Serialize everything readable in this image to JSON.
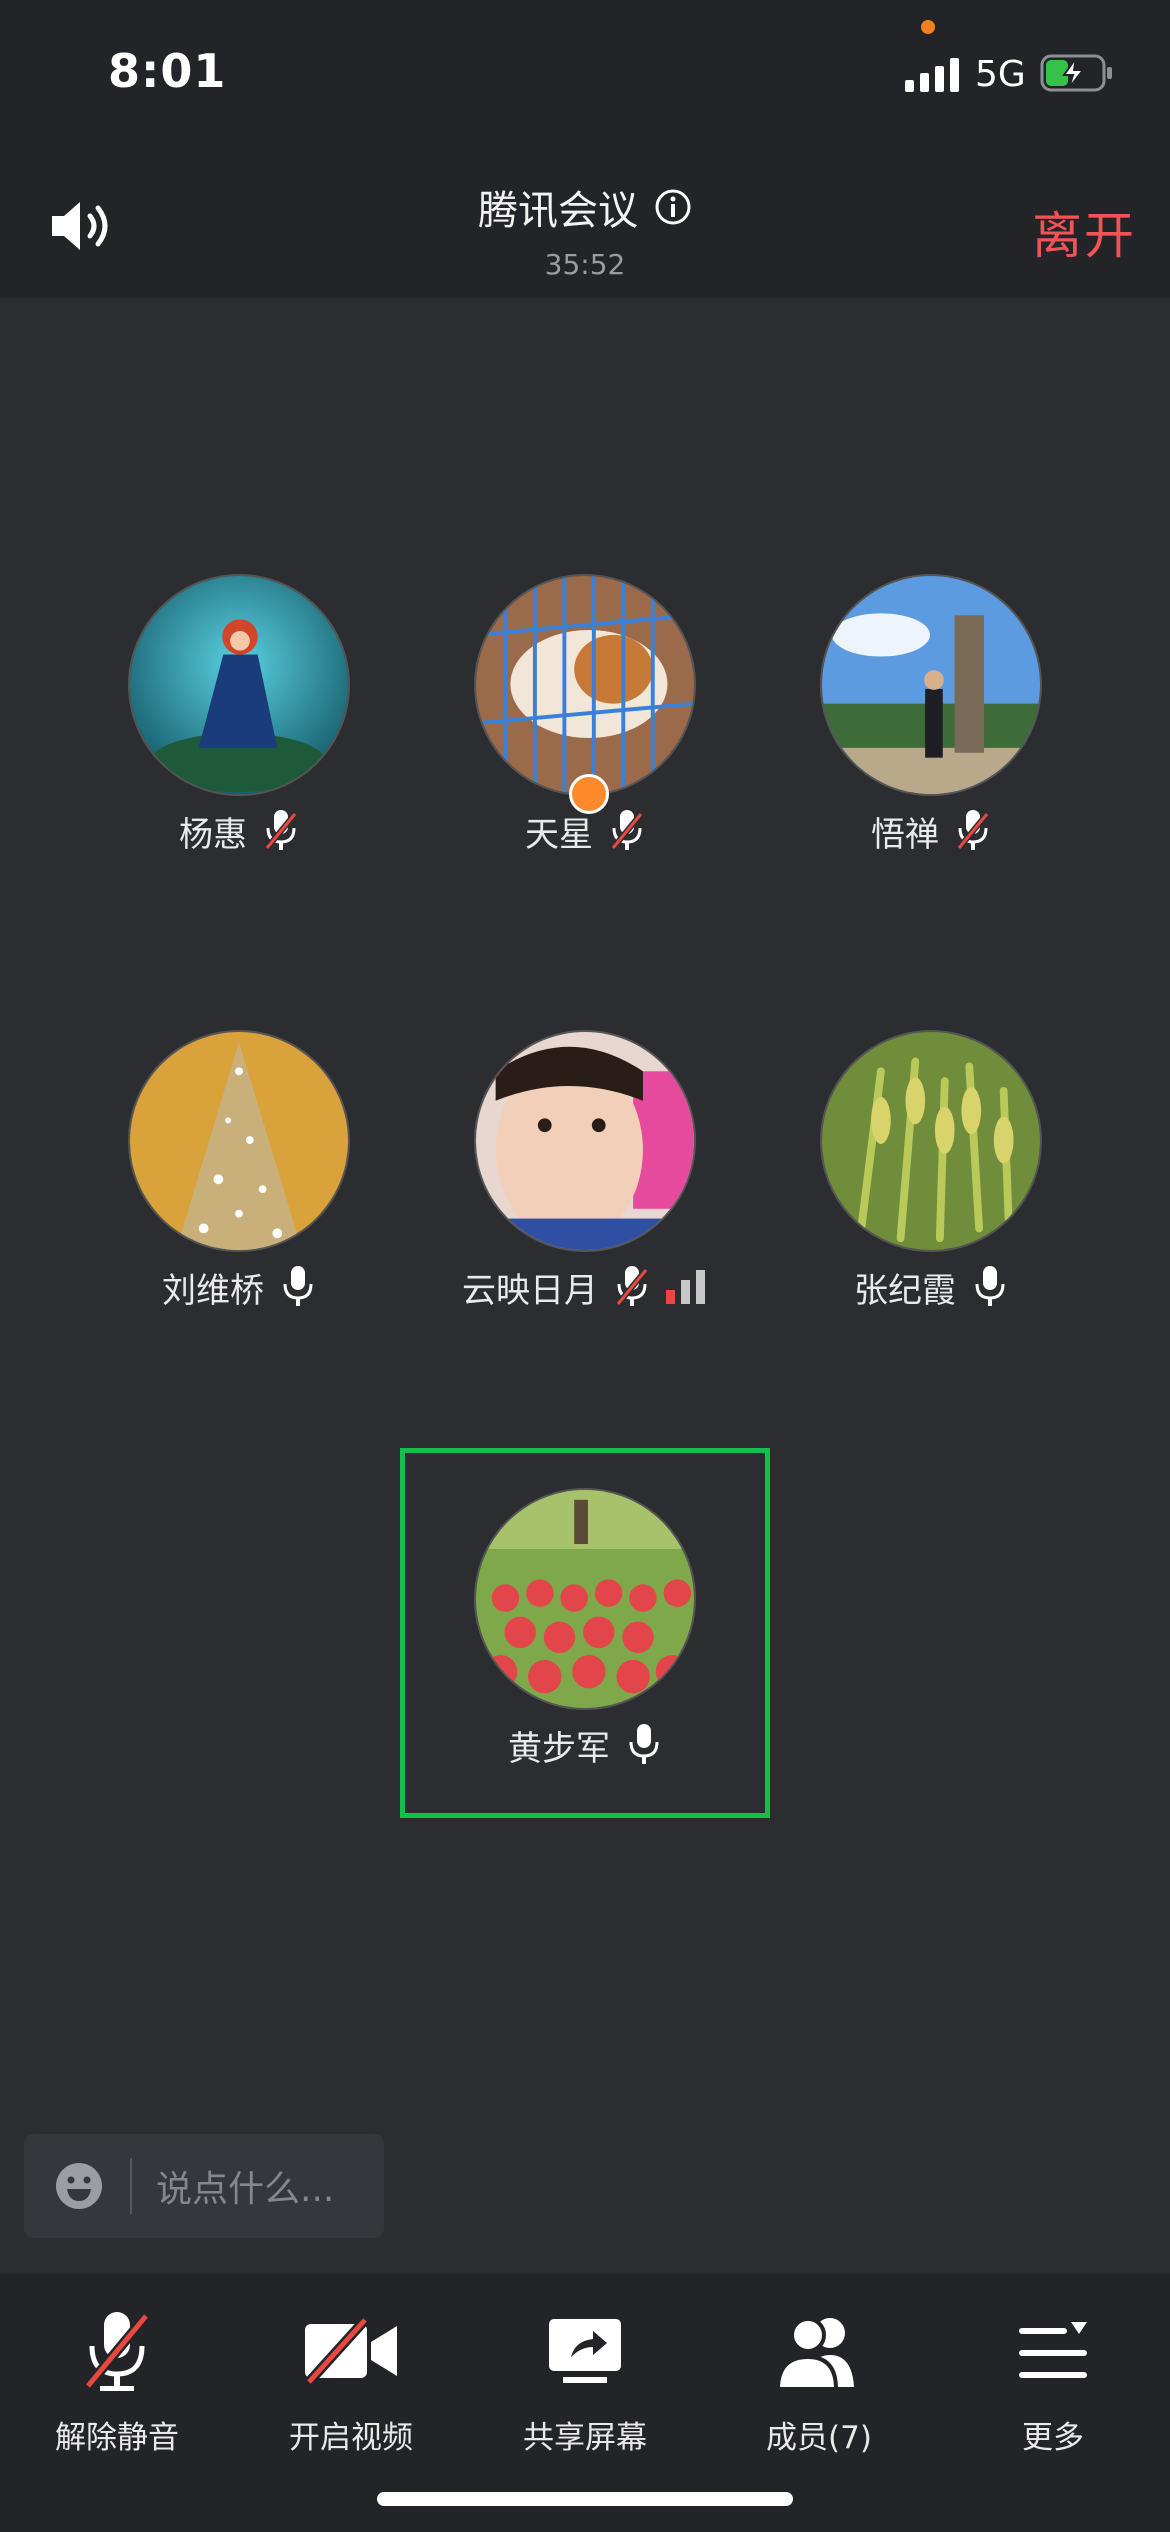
{
  "status_bar": {
    "time": "8:01",
    "network": "5G"
  },
  "header": {
    "title": "腾讯会议",
    "timer": "35:52",
    "leave_label": "离开"
  },
  "participants": [
    {
      "name": "杨惠",
      "mic": "muted"
    },
    {
      "name": "天星",
      "mic": "muted",
      "host": true
    },
    {
      "name": "悟禅",
      "mic": "muted"
    },
    {
      "name": "刘维桥",
      "mic": "on"
    },
    {
      "name": "云映日月",
      "mic": "muted",
      "signal": "weak"
    },
    {
      "name": "张纪霞",
      "mic": "on"
    },
    {
      "name": "黄步军",
      "mic": "on",
      "speaking": true
    }
  ],
  "chat": {
    "placeholder": "说点什么..."
  },
  "toolbar": [
    {
      "label": "解除静音",
      "icon": "mic-muted-icon"
    },
    {
      "label": "开启视频",
      "icon": "video-off-icon"
    },
    {
      "label": "共享屏幕",
      "icon": "share-screen-icon"
    },
    {
      "label": "成员(7)",
      "icon": "members-icon"
    },
    {
      "label": "更多",
      "icon": "more-icon"
    }
  ],
  "colors": {
    "leave": "#f05456",
    "active_speaker": "#13c04d",
    "background": "#2b2d31"
  }
}
